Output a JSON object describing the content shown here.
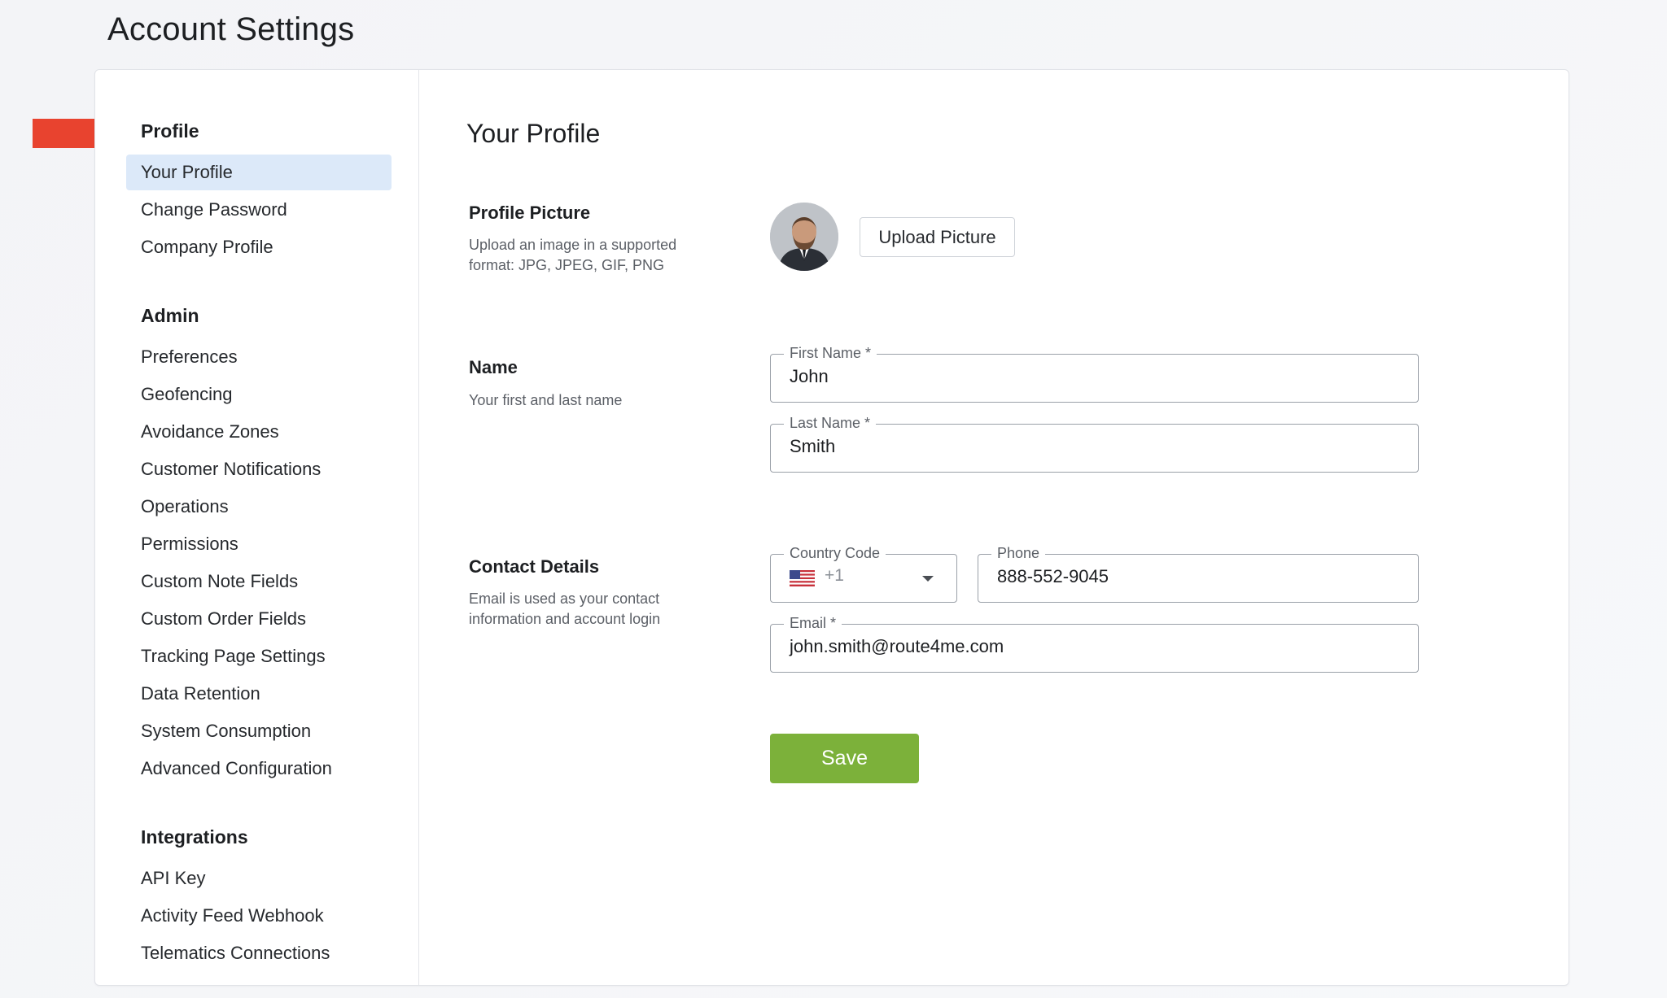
{
  "page": {
    "title": "Account Settings"
  },
  "sidebar": {
    "sections": [
      {
        "title": "Profile",
        "items": [
          "Your Profile",
          "Change Password",
          "Company Profile"
        ]
      },
      {
        "title": "Admin",
        "items": [
          "Preferences",
          "Geofencing",
          "Avoidance Zones",
          "Customer Notifications",
          "Operations",
          "Permissions",
          "Custom Note Fields",
          "Custom Order Fields",
          "Tracking Page Settings",
          "Data Retention",
          "System Consumption",
          "Advanced Configuration"
        ]
      },
      {
        "title": "Integrations",
        "items": [
          "API Key",
          "Activity Feed Webhook",
          "Telematics Connections"
        ]
      }
    ],
    "active_item": "Your Profile"
  },
  "main": {
    "title": "Your Profile",
    "profile_picture": {
      "label": "Profile Picture",
      "description": "Upload an image in a supported format: JPG, JPEG, GIF, PNG",
      "upload_label": "Upload Picture"
    },
    "name": {
      "label": "Name",
      "description": "Your first and last name",
      "first_name_legend": "First Name *",
      "first_name_value": "John",
      "last_name_legend": "Last Name *",
      "last_name_value": "Smith"
    },
    "contact": {
      "label": "Contact Details",
      "description": "Email is used as your contact information and account login",
      "country_code_legend": "Country Code",
      "country_code_value": "+1",
      "phone_legend": "Phone",
      "phone_value": "888-552-9045",
      "email_legend": "Email *",
      "email_value": "john.smith@route4me.com"
    },
    "save_label": "Save"
  },
  "colors": {
    "accent_green": "#7cb13a",
    "active_nav_bg": "#dce9f9",
    "arrow_red": "#e8432f"
  }
}
